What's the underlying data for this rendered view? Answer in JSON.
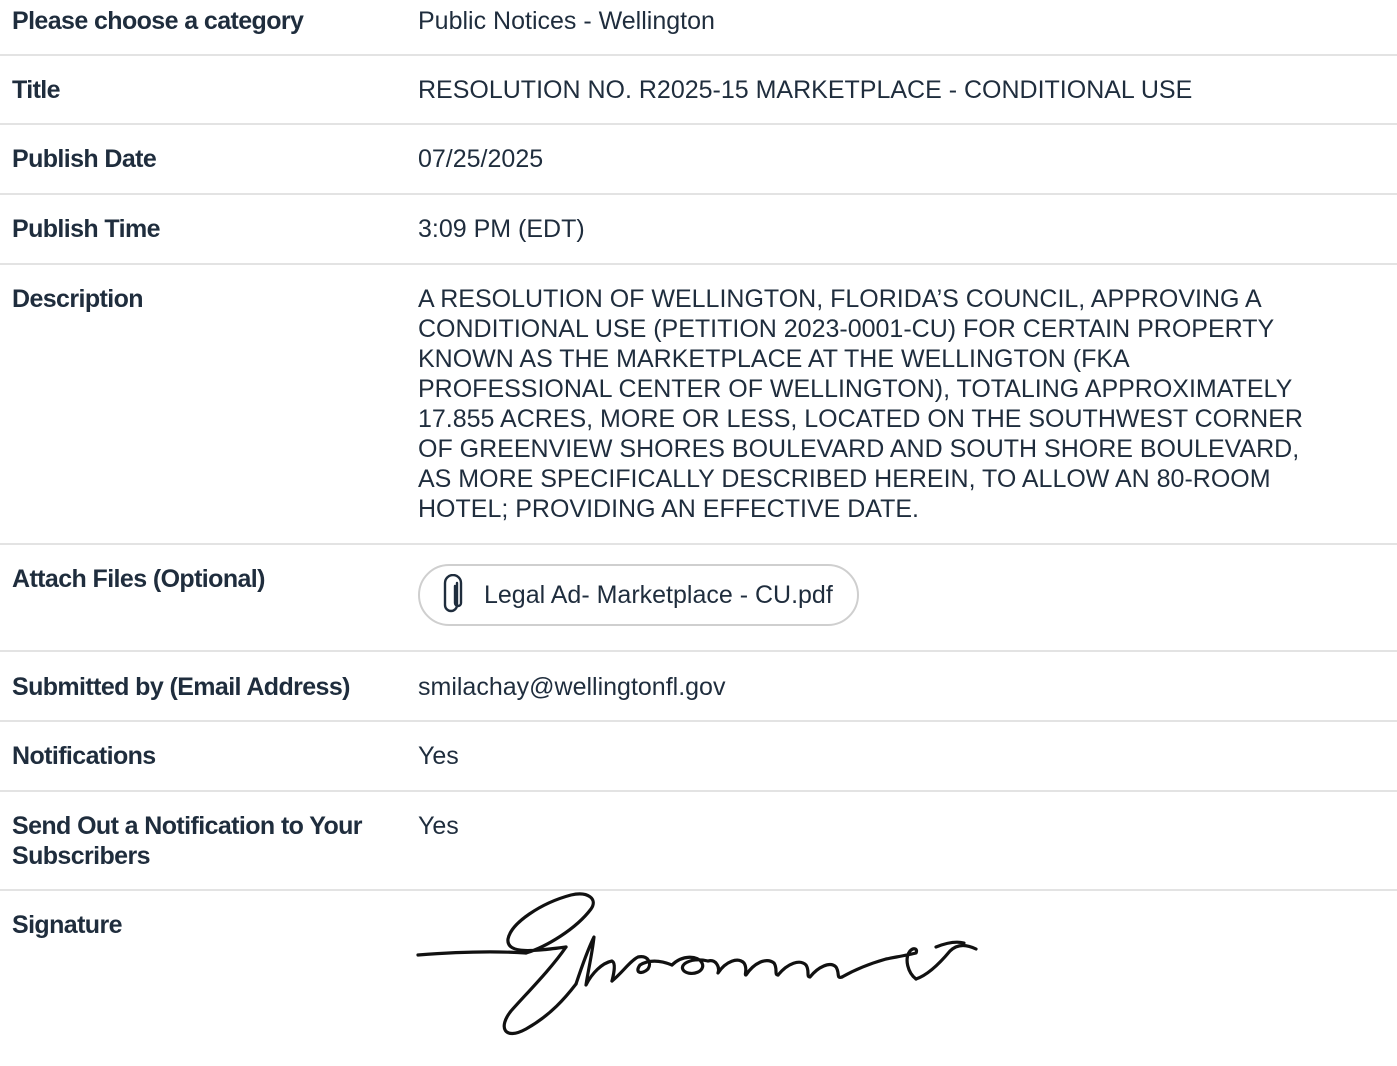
{
  "fields": {
    "category": {
      "label": "Please choose a category",
      "value": "Public Notices - Wellington"
    },
    "title": {
      "label": "Title",
      "value": "RESOLUTION NO. R2025-15 MARKETPLACE - CONDITIONAL USE"
    },
    "publish_date": {
      "label": "Publish Date",
      "value": "07/25/2025"
    },
    "publish_time": {
      "label": "Publish Time",
      "value": "3:09 PM (EDT)"
    },
    "description": {
      "label": "Description",
      "lines": [
        "A RESOLUTION OF WELLINGTON, FLORIDA’S COUNCIL, APPROVING A",
        "CONDITIONAL USE (PETITION 2023-0001-CU) FOR CERTAIN PROPERTY",
        "KNOWN AS THE MARKETPLACE AT THE WELLINGTON (FKA",
        "PROFESSIONAL CENTER OF WELLINGTON), TOTALING APPROXIMATELY",
        "17.855 ACRES, MORE OR LESS, LOCATED ON THE SOUTHWEST CORNER",
        "OF GREENVIEW SHORES BOULEVARD AND SOUTH SHORE BOULEVARD,",
        "AS MORE SPECIFICALLY DESCRIBED HEREIN, TO ALLOW AN 80-ROOM",
        "HOTEL; PROVIDING AN EFFECTIVE DATE."
      ]
    },
    "attach_files": {
      "label": "Attach Files (Optional)",
      "file_name": "Legal Ad- Marketplace - CU.pdf",
      "icon": "paperclip-icon"
    },
    "submitted_by": {
      "label": "Submitted by (Email Address)",
      "value": "smilachay@wellingtonfl.gov"
    },
    "notifications": {
      "label": "Notifications",
      "value": "Yes"
    },
    "send_notification": {
      "label_lines": [
        "Send Out a Notification to Your",
        "Subscribers"
      ],
      "value": "Yes"
    },
    "signature": {
      "label": "Signature"
    }
  },
  "colors": {
    "text": "#1f2d3d",
    "divider": "#e3e3e3",
    "chip_border": "#cfcfcf"
  }
}
